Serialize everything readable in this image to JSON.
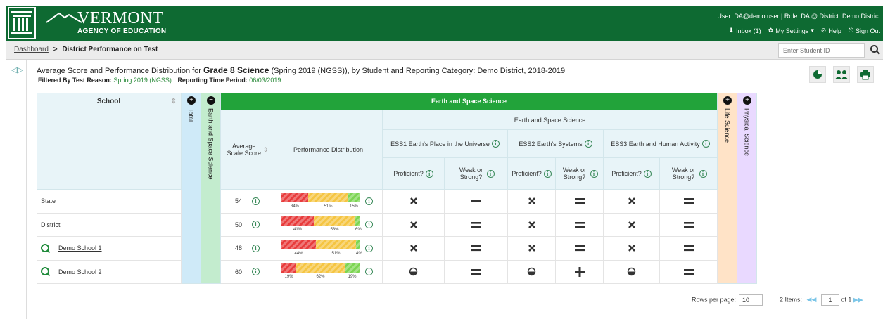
{
  "header": {
    "brand": "VERMONT",
    "agency": "AGENCY OF EDUCATION",
    "user_line": "User: DA@demo.user | Role: DA @ District: Demo District",
    "links": [
      "Inbox (1)",
      "My Settings",
      "Help",
      "Sign Out"
    ]
  },
  "breadcrumb": {
    "home": "Dashboard",
    "sep": ">",
    "current": "District Performance on Test"
  },
  "search": {
    "placeholder": "Enter Student ID"
  },
  "report": {
    "title_pre": "Average Score and Performance Distribution for ",
    "title_bold": "Grade 8 Science",
    "title_post": " (Spring 2019 (NGSS)), by Student and Reporting Category: Demo District, 2018-2019",
    "filter_label": "Filtered By Test Reason:",
    "filter_value": "Spring 2019 (NGSS)",
    "period_label": "Reporting Time Period:",
    "period_value": "06/03/2019"
  },
  "table": {
    "school_header": "School",
    "total": "Total",
    "ess_col": "Earth and Space Science",
    "band": "Earth and Space Science",
    "sub_band": "Earth and Space Science",
    "avg": "Average Scale Score",
    "perf": "Performance Distribution",
    "targets": [
      "ESS1 Earth's Place in the Universe",
      "ESS2 Earth's Systems",
      "ESS3 Earth and Human Activity"
    ],
    "prof": "Proficient?",
    "weak": "Weak or Strong?",
    "life": "Life Science",
    "physical": "Physical Science",
    "rows": [
      {
        "name": "State",
        "score": "54",
        "dist": [
          34,
          51,
          15
        ],
        "labels": [
          "34%",
          "51%",
          "15%"
        ],
        "marks": [
          "x",
          "minus",
          "x",
          "eq",
          "x",
          "eq"
        ],
        "link": false
      },
      {
        "name": "District",
        "score": "50",
        "dist": [
          41,
          53,
          6
        ],
        "labels": [
          "41%",
          "53%",
          "6%"
        ],
        "marks": [
          "x",
          "eq",
          "x",
          "eq",
          "x",
          "eq"
        ],
        "link": false
      },
      {
        "name": "Demo School 1",
        "score": "48",
        "dist": [
          44,
          51,
          4
        ],
        "labels": [
          "44%",
          "51%",
          "4%"
        ],
        "marks": [
          "x",
          "eq",
          "x",
          "eq",
          "x",
          "eq"
        ],
        "link": true
      },
      {
        "name": "Demo School 2",
        "score": "60",
        "dist": [
          19,
          62,
          19
        ],
        "labels": [
          "19%",
          "62%",
          "19%"
        ],
        "marks": [
          "half",
          "eq",
          "half",
          "plus",
          "half",
          "eq"
        ],
        "link": true
      }
    ]
  },
  "pager": {
    "rows_label": "Rows per page:",
    "rows_value": "10",
    "items": "2 Items:",
    "page": "1",
    "of": "of 1"
  },
  "colors": {
    "green": "#0e6a32",
    "band": "#22a33a",
    "red": "#e83c3c",
    "yellow": "#f5c542",
    "lightgreen": "#7cd552",
    "orange": "#ffe3c7",
    "lilac": "#e9d9ff"
  }
}
